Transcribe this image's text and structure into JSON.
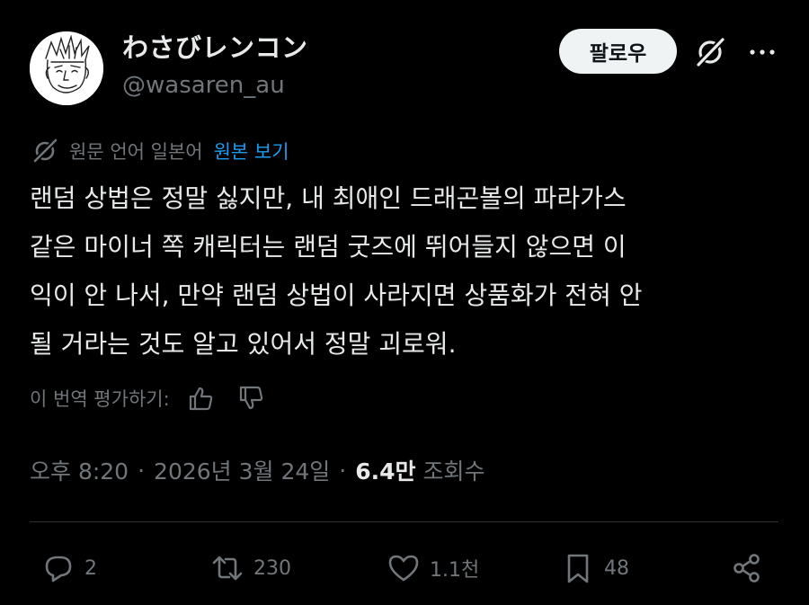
{
  "author": {
    "display_name": "わさびレンコン",
    "handle": "@wasaren_au"
  },
  "header": {
    "follow_label": "팔로우"
  },
  "translation": {
    "label": "원문 언어 일본어",
    "show_original": "원본 보기"
  },
  "tweet": {
    "lines": [
      "랜덤 상법은 정말 싫지만, 내 최애인 드래곤볼의 파라가스",
      "같은 마이너 쪽 캐릭터는 랜덤 굿즈에 뛰어들지 않으면 이",
      "익이 안 나서, 만약 랜덤 상법이 사라지면 상품화가 전혀 안",
      "될 거라는 것도 알고 있어서 정말 괴로워."
    ]
  },
  "rate": {
    "label": "이 번역 평가하기:"
  },
  "meta": {
    "time": "오후 8:20",
    "date": "2026년 3월 24일",
    "separator": "·",
    "views_count": "6.4만",
    "views_label": "조회수"
  },
  "actions": {
    "replies": "2",
    "reposts": "230",
    "likes": "1.1천",
    "bookmarks": "48"
  },
  "colors": {
    "background": "#000000",
    "text": "#e7e9ea",
    "secondary": "#71767b",
    "link": "#1d9bf0",
    "divider": "#2f3336",
    "follow_bg": "#eff3f4"
  },
  "icons": {
    "grok": "grok-icon",
    "more": "more-icon",
    "translate": "grok-translate-icon",
    "thumbs_up": "thumbs-up-icon",
    "thumbs_down": "thumbs-down-icon",
    "reply": "reply-icon",
    "repost": "repost-icon",
    "like": "heart-icon",
    "bookmark": "bookmark-icon",
    "share": "share-icon"
  }
}
